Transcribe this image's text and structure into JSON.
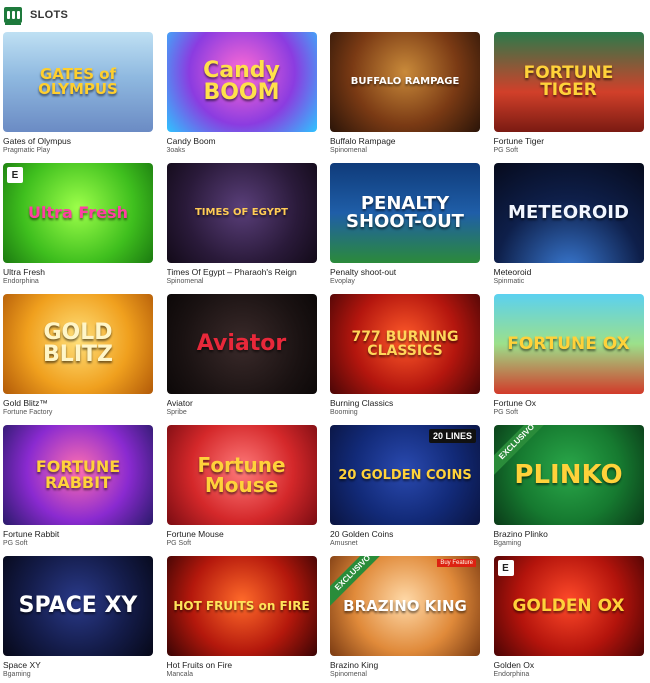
{
  "header": {
    "title": "SLOTS",
    "icon": "slot-machine-icon"
  },
  "games": [
    {
      "key": "gates-of-olympus",
      "name": "Gates of Olympus",
      "provider": "Pragmatic Play",
      "art": "GATES of OLYMPUS",
      "bg": "linear-gradient(180deg,#bfe0f3 0%,#8fb9e0 45%,#6b8bc4 100%)",
      "fg": "#ffcf2e",
      "size": "15px"
    },
    {
      "key": "candy-boom",
      "name": "Candy Boom",
      "provider": "3oaks",
      "art": "Candy BOOM",
      "bg": "radial-gradient(circle at 50% 40%,#ff6ad5 0%,#8b3ce0 55%,#2ec4ff 100%)",
      "fg": "#ffe14a",
      "size": "22px"
    },
    {
      "key": "buffalo-rampage",
      "name": "Buffalo Rampage",
      "provider": "Spinomenal",
      "art": "BUFFALO RAMPAGE",
      "bg": "radial-gradient(circle at 50% 40%,#c98a3a 0%,#7a3a14 55%,#2a1408 100%)",
      "fg": "#ffffff",
      "size": "10px"
    },
    {
      "key": "fortune-tiger",
      "name": "Fortune Tiger",
      "provider": "PG Soft",
      "art": "FORTUNE TIGER",
      "bg": "linear-gradient(180deg,#2b7a4b 0%,#d1402a 60%,#7a1a12 100%)",
      "fg": "#ffd23a",
      "size": "17px"
    },
    {
      "key": "ultra-fresh",
      "name": "Ultra Fresh",
      "provider": "Endorphina",
      "art": "Ultra Fresh",
      "bg": "radial-gradient(circle at 50% 45%,#9dff4a 0%,#3fbf1e 60%,#1b7a10 100%)",
      "fg": "#ff3fa3",
      "size": "16px",
      "badge": "E"
    },
    {
      "key": "times-of-egypt",
      "name": "Times Of Egypt – Pharaoh's Reign",
      "provider": "Spinomenal",
      "art": "TIMES OF EGYPT",
      "bg": "radial-gradient(circle at 50% 45%,#5a3f7a 0%,#2a1a3a 60%,#120a18 100%)",
      "fg": "#ffcc55",
      "size": "10px"
    },
    {
      "key": "penalty-shoot-out",
      "name": "Penalty shoot-out",
      "provider": "Evoplay",
      "art": "PENALTY SHOOT-OUT",
      "bg": "linear-gradient(180deg,#0f3b7a 0%,#1f5ea8 50%,#2b8a3a 100%)",
      "fg": "#ffffff",
      "size": "18px"
    },
    {
      "key": "meteoroid",
      "name": "Meteoroid",
      "provider": "Spinmatic",
      "art": "METEOROID",
      "bg": "radial-gradient(circle at 50% 110%,#3a7bd5 0%,#0e1f4a 55%,#060a1c 100%)",
      "fg": "#f2f6ff",
      "size": "18px"
    },
    {
      "key": "gold-blitz",
      "name": "Gold Blitz™",
      "provider": "Fortune Factory",
      "art": "GOLD BLITZ",
      "bg": "radial-gradient(circle at 50% 45%,#ffe07a 0%,#f0a01e 55%,#b25a08 100%)",
      "fg": "#fff6c8",
      "size": "22px"
    },
    {
      "key": "aviator",
      "name": "Aviator",
      "provider": "Spribe",
      "art": "Aviator",
      "bg": "radial-gradient(circle at 50% 50%,#3a2a2a 0%,#1a1212 65%,#0c0808 100%)",
      "fg": "#e8283a",
      "size": "22px"
    },
    {
      "key": "burning-classics",
      "name": "Burning Classics",
      "provider": "Booming",
      "art": "777 BURNING CLASSICS",
      "bg": "radial-gradient(circle at 50% 45%,#ff5a2a 0%,#b4160e 55%,#4a0606 100%)",
      "fg": "#ffd65a",
      "size": "14px"
    },
    {
      "key": "fortune-ox",
      "name": "Fortune Ox",
      "provider": "PG Soft",
      "art": "FORTUNE OX",
      "bg": "linear-gradient(180deg,#5bd1f0 0%,#9ce08a 50%,#d23a2a 100%)",
      "fg": "#ffd23a",
      "size": "17px"
    },
    {
      "key": "fortune-rabbit",
      "name": "Fortune Rabbit",
      "provider": "PG Soft",
      "art": "FORTUNE RABBIT",
      "bg": "radial-gradient(circle at 50% 45%,#ff6fb0 0%,#8a2ad0 55%,#2a1a6a 100%)",
      "fg": "#ffd23a",
      "size": "16px"
    },
    {
      "key": "fortune-mouse",
      "name": "Fortune Mouse",
      "provider": "PG Soft",
      "art": "Fortune Mouse",
      "bg": "radial-gradient(circle at 50% 45%,#ff7a7a 0%,#d4282a 55%,#7a0c12 100%)",
      "fg": "#ffd23a",
      "size": "20px"
    },
    {
      "key": "20-golden-coins",
      "name": "20 Golden Coins",
      "provider": "Amusnet",
      "art": "20 GOLDEN COINS",
      "bg": "radial-gradient(circle at 50% 45%,#2a4ab0 0%,#122a78 55%,#0a1440 100%)",
      "fg": "#ffd23a",
      "size": "13px",
      "tag": "20 LINES"
    },
    {
      "key": "brazino-plinko",
      "name": "Brazino Plinko",
      "provider": "Bgaming",
      "art": "PLINKO",
      "bg": "radial-gradient(circle at 50% 45%,#2aa84a 0%,#167a30 55%,#0a3a18 100%)",
      "fg": "#ffd23a",
      "size": "26px",
      "ribbon": "EXCLUSIVO"
    },
    {
      "key": "space-xy",
      "name": "Space XY",
      "provider": "Bgaming",
      "art": "SPACE XY",
      "bg": "radial-gradient(circle at 50% 45%,#2a3a8a 0%,#141c4a 55%,#060818 100%)",
      "fg": "#ffffff",
      "size": "22px"
    },
    {
      "key": "hot-fruits-on-fire",
      "name": "Hot Fruits on Fire",
      "provider": "Mancala",
      "art": "HOT FRUITS on FIRE",
      "bg": "radial-gradient(circle at 50% 45%,#ff6a2a 0%,#b4180c 55%,#3a0404 100%)",
      "fg": "#ffe45a",
      "size": "12px"
    },
    {
      "key": "brazino-king",
      "name": "Brazino King",
      "provider": "Spinomenal",
      "art": "BRAZINO KING",
      "bg": "radial-gradient(circle at 50% 45%,#ffd9a8 0%,#e08a3a 55%,#7a3a12 100%)",
      "fg": "#ffffff",
      "size": "15px",
      "ribbon": "EXCLUSIVO",
      "tag2": "Buy Feature"
    },
    {
      "key": "golden-ox",
      "name": "Golden Ox",
      "provider": "Endorphina",
      "art": "GOLDEN OX",
      "bg": "radial-gradient(circle at 50% 45%,#ff4a2a 0%,#b4140c 55%,#4a0404 100%)",
      "fg": "#ffd23a",
      "size": "17px",
      "badge": "E"
    }
  ]
}
